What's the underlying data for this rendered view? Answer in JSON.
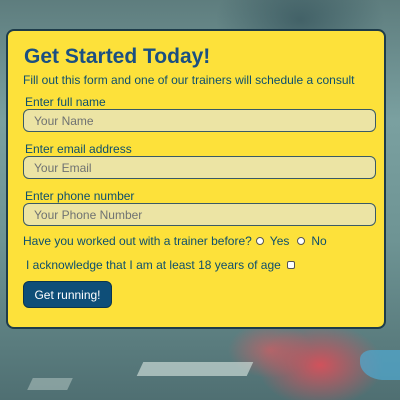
{
  "form": {
    "title": "Get Started Today!",
    "subtitle": "Fill out this form and one of our trainers will schedule a consult",
    "name_label": "Enter full name",
    "name_placeholder": "Your Name",
    "email_label": "Enter email address",
    "email_placeholder": "Your Email",
    "phone_label": "Enter phone number",
    "phone_placeholder": "Your Phone Number",
    "trainer_question": "Have you worked out with a trainer before?",
    "option_yes": "Yes",
    "option_no": "No",
    "acknowledge": "I acknowledge that I am at least 18 years of age",
    "submit_label": "Get running!"
  },
  "colors": {
    "card_background": "#fde13a",
    "title": "#1a4f82",
    "button": "#0e4e78"
  }
}
